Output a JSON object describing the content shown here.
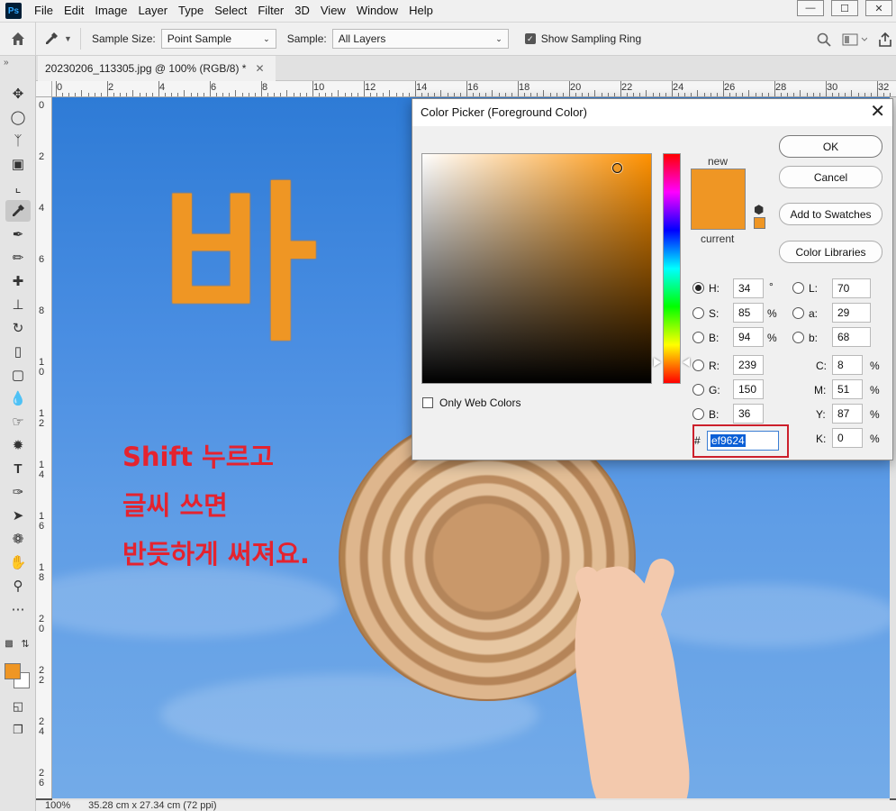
{
  "app": {
    "logo": "Ps",
    "menu": [
      "File",
      "Edit",
      "Image",
      "Layer",
      "Type",
      "Select",
      "Filter",
      "3D",
      "View",
      "Window",
      "Help"
    ],
    "window_controls": [
      "—",
      "☐",
      "✕"
    ]
  },
  "options": {
    "sample_size_label": "Sample Size:",
    "sample_size_value": "Point Sample",
    "sample_label": "Sample:",
    "sample_value": "All Layers",
    "show_ring_label": "Show Sampling Ring",
    "show_ring_checked": true
  },
  "document": {
    "tab_title": "20230206_113305.jpg @ 100% (RGB/8) *",
    "zoom": "100%",
    "dimensions": "35.28 cm x 27.34 cm (72 ppi)"
  },
  "rulers": {
    "horizontal": [
      "0",
      "2",
      "4",
      "6",
      "8",
      "10",
      "12",
      "14",
      "16",
      "18",
      "20",
      "22",
      "24",
      "26",
      "28",
      "30",
      "32"
    ],
    "vertical": [
      "0",
      "2",
      "4",
      "6",
      "8",
      "10",
      "12",
      "14",
      "16",
      "18",
      "20",
      "22",
      "24",
      "26"
    ]
  },
  "canvas": {
    "big_character": "바",
    "text_lines": [
      "Shift 누르고",
      "글씨 쓰면",
      "반듯하게 써져요."
    ],
    "colors": {
      "big_character": "#ef9624",
      "text": "#e4232f"
    }
  },
  "tools": {
    "foreground_color": "#ef9624",
    "background_color": "#ffffff",
    "icons": [
      "move-icon",
      "marquee-icon",
      "lasso-icon",
      "object-select-icon",
      "crop-icon",
      "eyedropper-icon",
      "brush-icon",
      "pencil-icon",
      "healing-icon",
      "clone-stamp-icon",
      "history-brush-icon",
      "eraser-icon",
      "gradient-icon",
      "blur-icon",
      "smudge-icon",
      "sponge-icon",
      "type-icon",
      "pen-icon",
      "path-select-icon",
      "shape-icon",
      "hand-icon",
      "zoom-icon",
      "more-tools-icon"
    ]
  },
  "color_picker": {
    "title": "Color Picker (Foreground Color)",
    "close": "✕",
    "new_label": "new",
    "current_label": "current",
    "new_color": "#ef9624",
    "current_color": "#ef9624",
    "buttons": {
      "ok": "OK",
      "cancel": "Cancel",
      "add_swatches": "Add to Swatches",
      "libraries": "Color Libraries"
    },
    "only_web_colors": "Only Web Colors",
    "hsb": {
      "h": {
        "label": "H:",
        "value": "34",
        "unit": "°"
      },
      "s": {
        "label": "S:",
        "value": "85",
        "unit": "%"
      },
      "b": {
        "label": "B:",
        "value": "94",
        "unit": "%"
      }
    },
    "rgb": {
      "r": {
        "label": "R:",
        "value": "239"
      },
      "g": {
        "label": "G:",
        "value": "150"
      },
      "b": {
        "label": "B:",
        "value": "36"
      }
    },
    "lab": {
      "l": {
        "label": "L:",
        "value": "70"
      },
      "a": {
        "label": "a:",
        "value": "29"
      },
      "b": {
        "label": "b:",
        "value": "68"
      }
    },
    "cmyk": {
      "c": {
        "label": "C:",
        "value": "8",
        "unit": "%"
      },
      "m": {
        "label": "M:",
        "value": "51",
        "unit": "%"
      },
      "y": {
        "label": "Y:",
        "value": "87",
        "unit": "%"
      },
      "k": {
        "label": "K:",
        "value": "0",
        "unit": "%"
      }
    },
    "hex_label": "#",
    "hex_value": "ef9624"
  }
}
